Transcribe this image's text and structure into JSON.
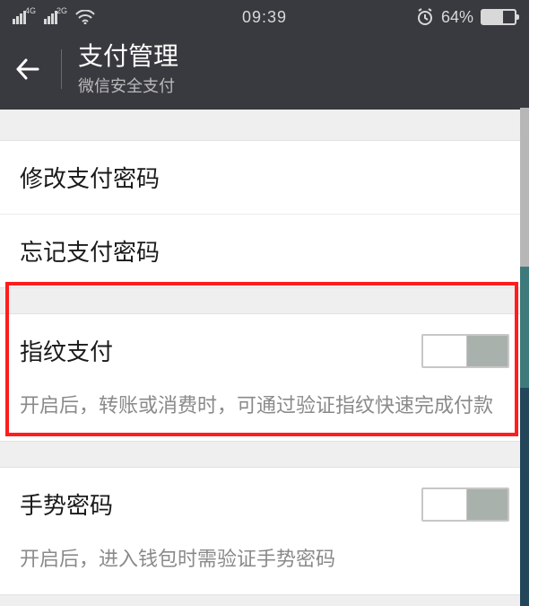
{
  "status": {
    "signal1_label": "4G",
    "signal2_label": "2G",
    "time": "09:39",
    "battery_pct": "64%"
  },
  "nav": {
    "title": "支付管理",
    "subtitle": "微信安全支付"
  },
  "rows": {
    "change_pwd": "修改支付密码",
    "forgot_pwd": "忘记支付密码",
    "fingerprint_title": "指纹支付",
    "fingerprint_desc": "开启后，转账或消费时，可通过验证指纹快速完成付款",
    "gesture_title": "手势密码",
    "gesture_desc": "开启后，进入钱包时需验证手势密码"
  }
}
